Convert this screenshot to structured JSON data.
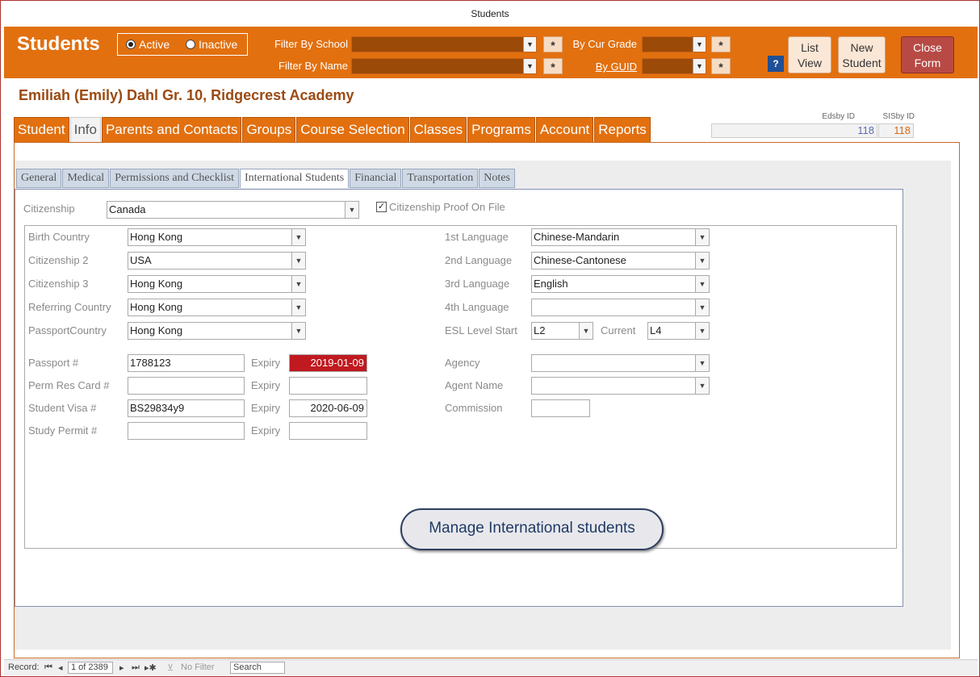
{
  "window": {
    "title": "Students"
  },
  "header": {
    "title": "Students",
    "status_filter": {
      "active_label": "Active",
      "inactive_label": "Inactive",
      "selected": "Active"
    },
    "filter_school_label": "Filter By School",
    "filter_name_label": "Filter By Name",
    "cur_grade_label": "By Cur Grade",
    "guid_label": "By GUID",
    "clear_label": "*",
    "help_label": "?",
    "list_view_line1": "List",
    "list_view_line2": "View",
    "new_student_line1": "New",
    "new_student_line2": "Student",
    "close_form_line1": "Close",
    "close_form_line2": "Form"
  },
  "student": {
    "heading": "Emiliah (Emily)  Dahl  Gr. 10, Ridgecrest Academy"
  },
  "ids": {
    "edsby_label": "Edsby ID",
    "edsby_value": "118",
    "sisby_label": "SISby ID",
    "sisby_value": "118"
  },
  "main_tabs": [
    "Student",
    "Info",
    "Parents and Contacts",
    "Groups",
    "Course Selection",
    "Classes",
    "Programs",
    "Account",
    "Reports"
  ],
  "sub_tabs": [
    "General",
    "Medical",
    "Permissions and Checklist",
    "International Students",
    "Financial",
    "Transportation",
    "Notes"
  ],
  "form": {
    "citizenship_label": "Citizenship",
    "citizenship_value": "Canada",
    "proof_label": "Citizenship Proof On File",
    "birth_country_label": "Birth Country",
    "birth_country_value": "Hong Kong",
    "citizenship2_label": "Citizenship 2",
    "citizenship2_value": "USA",
    "citizenship3_label": "Citizenship 3",
    "citizenship3_value": "Hong Kong",
    "referring_label": "Referring Country",
    "referring_value": "Hong Kong",
    "passport_country_label": "PassportCountry",
    "passport_country_value": "Hong Kong",
    "lang1_label": "1st Language",
    "lang1_value": "Chinese-Mandarin",
    "lang2_label": "2nd Language",
    "lang2_value": "Chinese-Cantonese",
    "lang3_label": "3rd Language",
    "lang3_value": "English",
    "lang4_label": "4th Language",
    "lang4_value": "",
    "esl_start_label": "ESL Level Start",
    "esl_start_value": "L2",
    "esl_current_label": "Current",
    "esl_current_value": "L4",
    "passport_label": "Passport #",
    "passport_value": "1788123",
    "expiry_label": "Expiry",
    "passport_expiry": "2019-01-09",
    "prc_label": "Perm Res Card #",
    "prc_value": "",
    "prc_expiry": "",
    "visa_label": "Student Visa #",
    "visa_value": "BS29834y9",
    "visa_expiry": "2020-06-09",
    "permit_label": "Study Permit #",
    "permit_value": "",
    "permit_expiry": "",
    "agency_label": "Agency",
    "agency_value": "",
    "agent_label": "Agent Name",
    "agent_value": "",
    "commission_label": "Commission",
    "commission_value": "",
    "manage_button": "Manage International students"
  },
  "statusbar": {
    "record_label": "Record:",
    "record_value": "1 of 2389",
    "filter_label": "No Filter",
    "search_label": "Search"
  },
  "colors": {
    "accent": "#e2700f",
    "expired": "#c0191f"
  }
}
